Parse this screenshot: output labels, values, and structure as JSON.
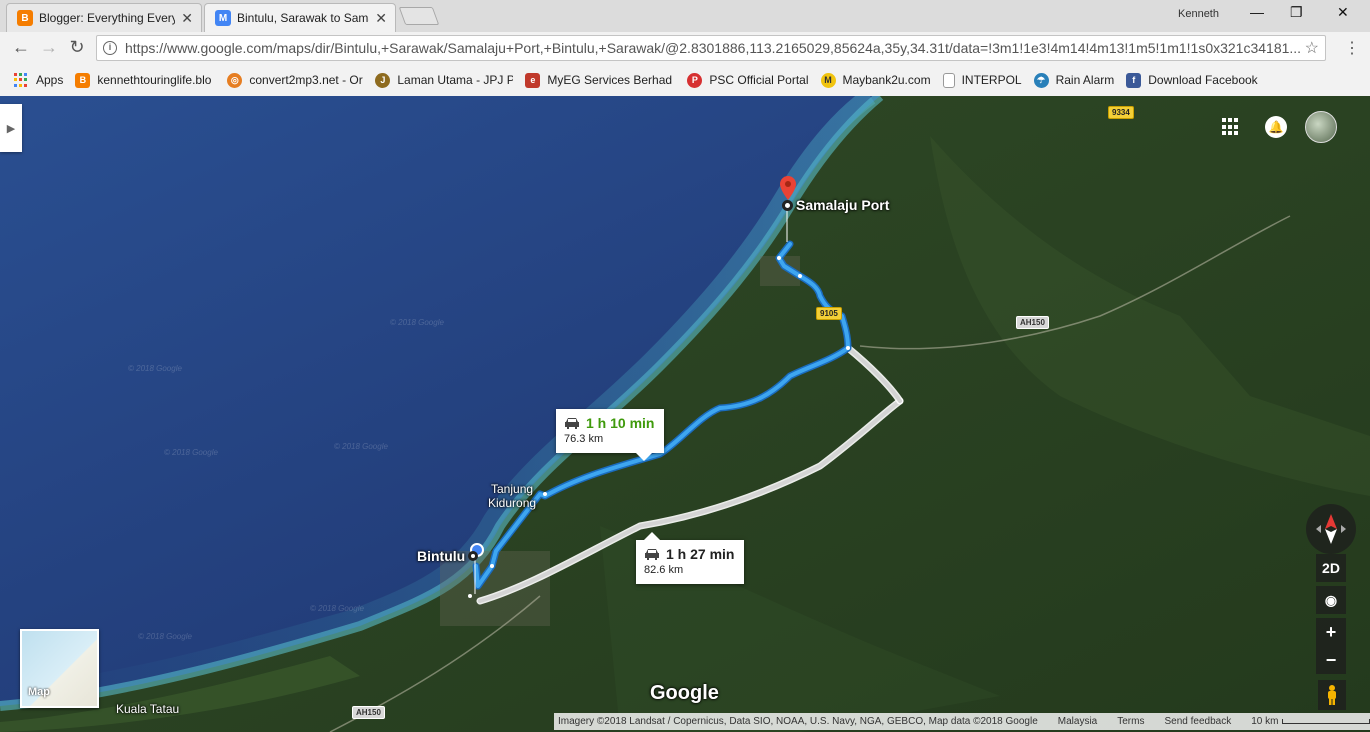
{
  "browser": {
    "tabs": [
      {
        "title": "Blogger: Everything Every",
        "icon_color": "#f57d00",
        "icon_glyph": "B"
      },
      {
        "title": "Bintulu, Sarawak to Sama",
        "icon_color": "#4285f4",
        "icon_glyph": "M"
      }
    ],
    "user": "Kenneth",
    "window_controls": {
      "minimize": "—",
      "maximize": "❐",
      "close": "✕"
    },
    "url": "https://www.google.com/maps/dir/Bintulu,+Sarawak/Samalaju+Port,+Bintulu,+Sarawak/@2.8301886,113.2165029,85624a,35y,34.31t/data=!3m1!1e3!4m14!4m13!1m5!1m1!1s0x321c34181...",
    "bookmarks": [
      {
        "label": "Apps",
        "icon": "apps-grid-icon",
        "color": "#e94235"
      },
      {
        "label": "kennethtouringlife.blo",
        "icon": "blogger-icon",
        "color": "#f57d00"
      },
      {
        "label": "convert2mp3.net - Or",
        "icon": "convert-icon",
        "color": "#e67e22"
      },
      {
        "label": "Laman Utama - JPJ Po",
        "icon": "jpj-icon",
        "color": "#8e6b1f"
      },
      {
        "label": "MyEG Services Berhad",
        "icon": "myeg-icon",
        "color": "#c0392b"
      },
      {
        "label": "PSC Official Portal",
        "icon": "psc-icon",
        "color": "#d63031"
      },
      {
        "label": "Maybank2u.com",
        "icon": "maybank-icon",
        "color": "#f1c40f"
      },
      {
        "label": "INTERPOL",
        "icon": "page-icon",
        "color": "#999999"
      },
      {
        "label": "Rain Alarm",
        "icon": "rain-alarm-icon",
        "color": "#2980b9"
      },
      {
        "label": "Download Facebook",
        "icon": "facebook-icon",
        "color": "#3b5998"
      }
    ]
  },
  "map": {
    "places": {
      "destination": "Samalaju Port",
      "origin": "Bintulu",
      "tanjung": "Tanjung\nKidurong",
      "kuala_tatau": "Kuala Tatau"
    },
    "routes": [
      {
        "time": "1 h 10 min",
        "distance": "76.3 km",
        "time_color": "#3f9a0c",
        "selected": true
      },
      {
        "time": "1 h 27 min",
        "distance": "82.6 km",
        "time_color": "#222222",
        "selected": false
      }
    ],
    "highways": {
      "route_9105": "9105",
      "ah150_a": "AH150",
      "ah150_b": "AH150",
      "top_badge": "9334"
    },
    "controls": {
      "view_mode": "2D",
      "zoom_in": "+",
      "zoom_out": "−",
      "minimap_label": "Map"
    },
    "logo": "Google",
    "watermark": "© 2018 Google",
    "attribution": {
      "imagery": "Imagery ©2018 Landsat / Copernicus, Data SIO, NOAA, U.S. Navy, NGA, GEBCO, Map data ©2018 Google",
      "country": "Malaysia",
      "terms": "Terms",
      "feedback": "Send feedback",
      "scale": "10 km"
    },
    "colors": {
      "route_primary": "#3ea6f0",
      "route_alt": "#d4d4d4",
      "pin": "#ea4335"
    }
  }
}
